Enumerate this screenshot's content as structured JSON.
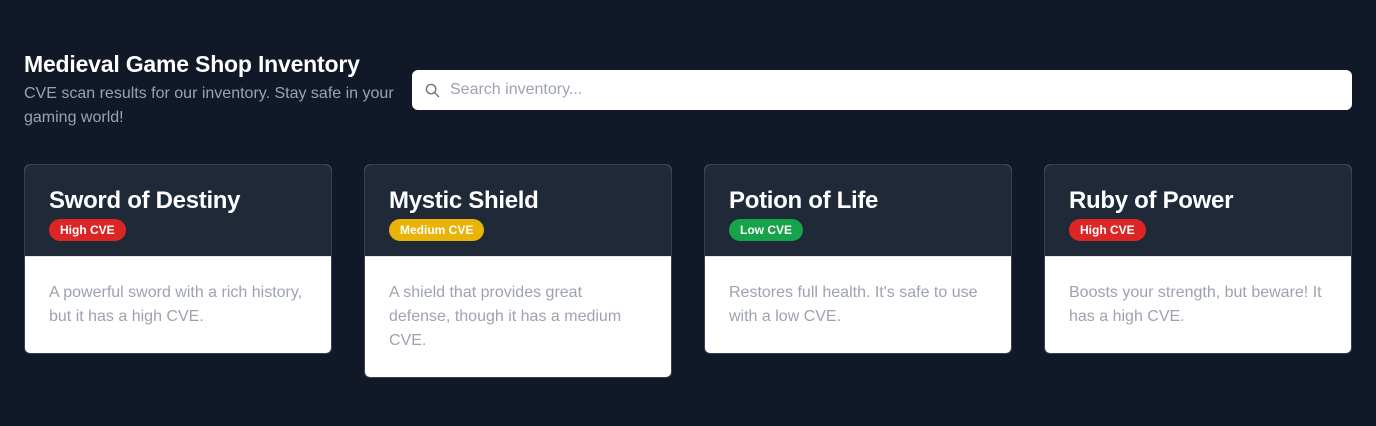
{
  "header": {
    "title": "Medieval Game Shop Inventory",
    "subtitle": "CVE scan results for our inventory. Stay safe in your gaming world!"
  },
  "search": {
    "placeholder": "Search inventory...",
    "value": "",
    "icon": "search-icon"
  },
  "colors": {
    "background": "#111827",
    "card_header": "#1f2937",
    "high": "#dc2626",
    "medium": "#eab308",
    "low": "#16a34a"
  },
  "items": [
    {
      "name": "Sword of Destiny",
      "badge": "High CVE",
      "severity": "high",
      "description": "A powerful sword with a rich history, but it has a high CVE."
    },
    {
      "name": "Mystic Shield",
      "badge": "Medium CVE",
      "severity": "medium",
      "description": "A shield that provides great defense, though it has a medium CVE."
    },
    {
      "name": "Potion of Life",
      "badge": "Low CVE",
      "severity": "low",
      "description": "Restores full health. It's safe to use with a low CVE."
    },
    {
      "name": "Ruby of Power",
      "badge": "High CVE",
      "severity": "high",
      "description": "Boosts your strength, but beware! It has a high CVE."
    }
  ]
}
